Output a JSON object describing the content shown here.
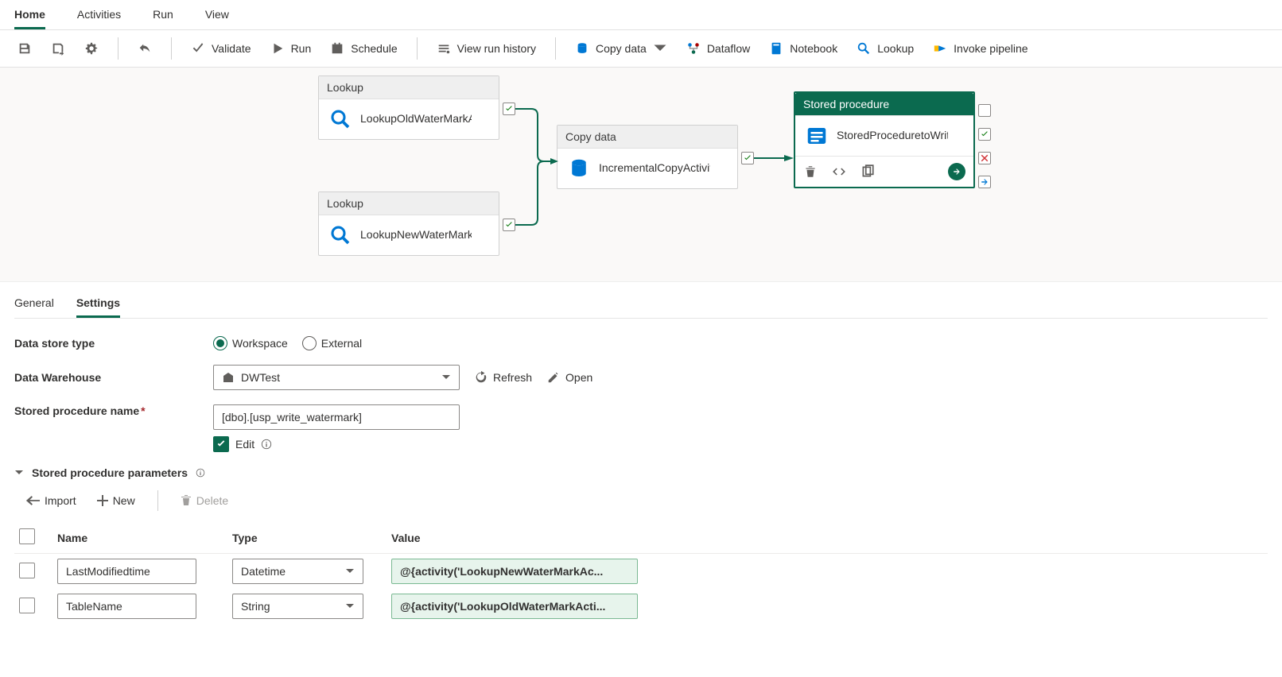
{
  "menu": {
    "items": [
      "Home",
      "Activities",
      "Run",
      "View"
    ],
    "active": 0
  },
  "toolbar": {
    "validate": "Validate",
    "run": "Run",
    "schedule": "Schedule",
    "view_run_history": "View run history",
    "copy_data": "Copy data",
    "dataflow": "Dataflow",
    "notebook": "Notebook",
    "lookup": "Lookup",
    "invoke_pipeline": "Invoke pipeline"
  },
  "canvas": {
    "nodes": {
      "lookup_old": {
        "type": "Lookup",
        "name": "LookupOldWaterMarkActivity"
      },
      "lookup_new": {
        "type": "Lookup",
        "name": "LookupNewWaterMarkActivity"
      },
      "copy": {
        "type": "Copy data",
        "name": "IncrementalCopyActivity"
      },
      "sproc": {
        "type": "Stored procedure",
        "name": "StoredProceduretoWriteWatermarkA..."
      }
    }
  },
  "panel": {
    "tabs": {
      "general": "General",
      "settings": "Settings",
      "active": "settings"
    },
    "form": {
      "data_store_type": {
        "label": "Data store type",
        "options": {
          "workspace": "Workspace",
          "external": "External"
        },
        "value": "workspace"
      },
      "data_warehouse": {
        "label": "Data Warehouse",
        "value": "DWTest",
        "refresh": "Refresh",
        "open": "Open"
      },
      "sproc_name": {
        "label": "Stored procedure name",
        "value": "[dbo].[usp_write_watermark]",
        "edit": "Edit"
      },
      "section": "Stored procedure parameters",
      "param_toolbar": {
        "import": "Import",
        "new": "New",
        "delete": "Delete"
      },
      "columns": {
        "name": "Name",
        "type": "Type",
        "value": "Value"
      },
      "rows": [
        {
          "name": "LastModifiedtime",
          "type": "Datetime",
          "value": "@{activity('LookupNewWaterMarkAc..."
        },
        {
          "name": "TableName",
          "type": "String",
          "value": "@{activity('LookupOldWaterMarkActi..."
        }
      ]
    }
  }
}
